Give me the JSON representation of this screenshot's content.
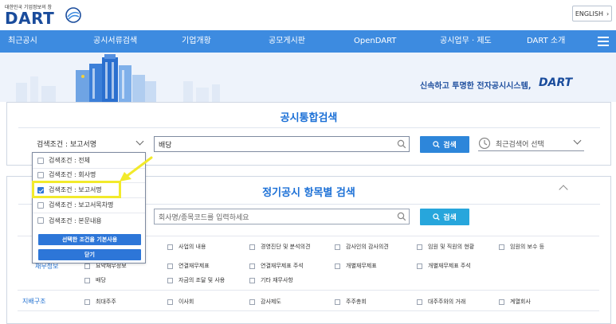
{
  "header": {
    "logo_subtitle": "대한민국 기업정보의 창",
    "logo_text": "DART",
    "english_button": "ENGLISH",
    "english_chevron": "›"
  },
  "nav": {
    "items": [
      "최근공시",
      "공시서류검색",
      "기업개황",
      "공모게시판",
      "OpenDART",
      "공시업무 · 제도",
      "DART 소개"
    ]
  },
  "hero": {
    "tagline": "신속하고 투명한 전자공시시스템,",
    "tagline_brand": "DART"
  },
  "integrated_search": {
    "title": "공시통합검색",
    "condition_label": "검색조건 : 보고서명",
    "query_value": "배당",
    "search_button": "검색",
    "recent_search_placeholder": "최근검색어 선택"
  },
  "condition_dropdown": {
    "options": [
      {
        "label": "검색조건 : 전체",
        "checked": false
      },
      {
        "label": "검색조건 : 회사명",
        "checked": false
      },
      {
        "label": "검색조건 : 보고서명",
        "checked": true
      },
      {
        "label": "검색조건 : 보고서목차명",
        "checked": false
      },
      {
        "label": "검색조건 : 본문내용",
        "checked": false
      }
    ],
    "apply_default_button": "선택한 조건을 기본사용",
    "close_button": "닫기"
  },
  "item_search": {
    "title": "정기공시 항목별 검색",
    "company_placeholder": "회사명/종목코드를 입력하세요",
    "search_button": "검색",
    "row_headers": [
      "재무정보",
      "지배구조"
    ],
    "row1": [
      "사업의 내용",
      "경영진단 및 분석의견",
      "감사인의 감사의견",
      "임원 및 직원의 현황",
      "임원의 보수 등"
    ],
    "row2": [
      "요약재무정보",
      "연결재무제표",
      "연결재무제표 주석",
      "개별재무제표",
      "개별재무제표 주석"
    ],
    "row3": [
      "배당",
      "자금의 조달 및 사용",
      "기타 재무사항"
    ],
    "row4": [
      "최대주주",
      "이사회",
      "감사제도",
      "주주총회",
      "대주주와의 거래",
      "계열회사"
    ]
  },
  "colors": {
    "nav_bg": "#3d8be0",
    "accent": "#1a6fd6",
    "button_bg": "#2d86da",
    "highlight": "#f2ea2b"
  }
}
